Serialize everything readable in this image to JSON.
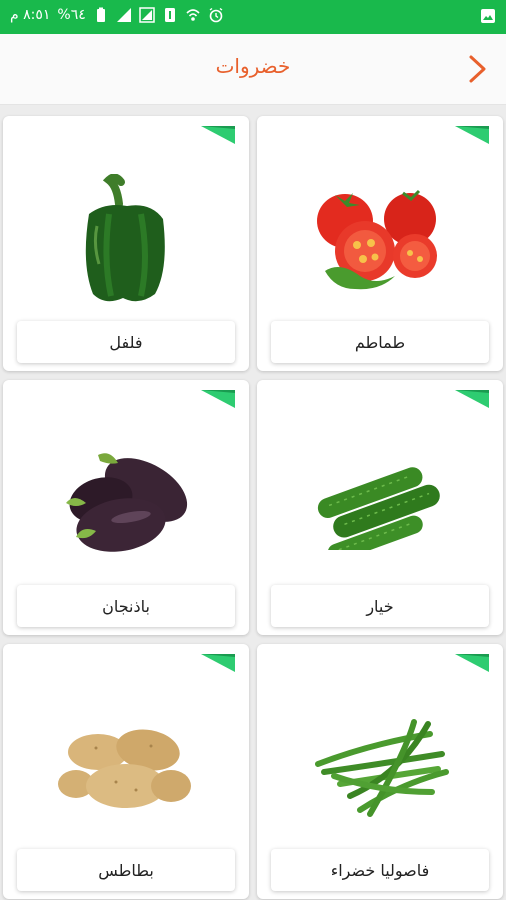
{
  "status_bar": {
    "time": "٨:٥١ م",
    "battery": "%٦٤"
  },
  "header": {
    "title": "خضروات"
  },
  "products": [
    {
      "name": "طماطم",
      "icon": "tomato-image"
    },
    {
      "name": "فلفل",
      "icon": "green-pepper-image"
    },
    {
      "name": "خيار",
      "icon": "cucumber-image"
    },
    {
      "name": "باذنجان",
      "icon": "eggplant-image"
    },
    {
      "name": "فاصوليا خضراء",
      "icon": "green-beans-image"
    },
    {
      "name": "بطاطس",
      "icon": "potato-image"
    }
  ],
  "colors": {
    "status_bar": "#19b94c",
    "accent": "#e8602c",
    "corner": "#2ecc71"
  }
}
